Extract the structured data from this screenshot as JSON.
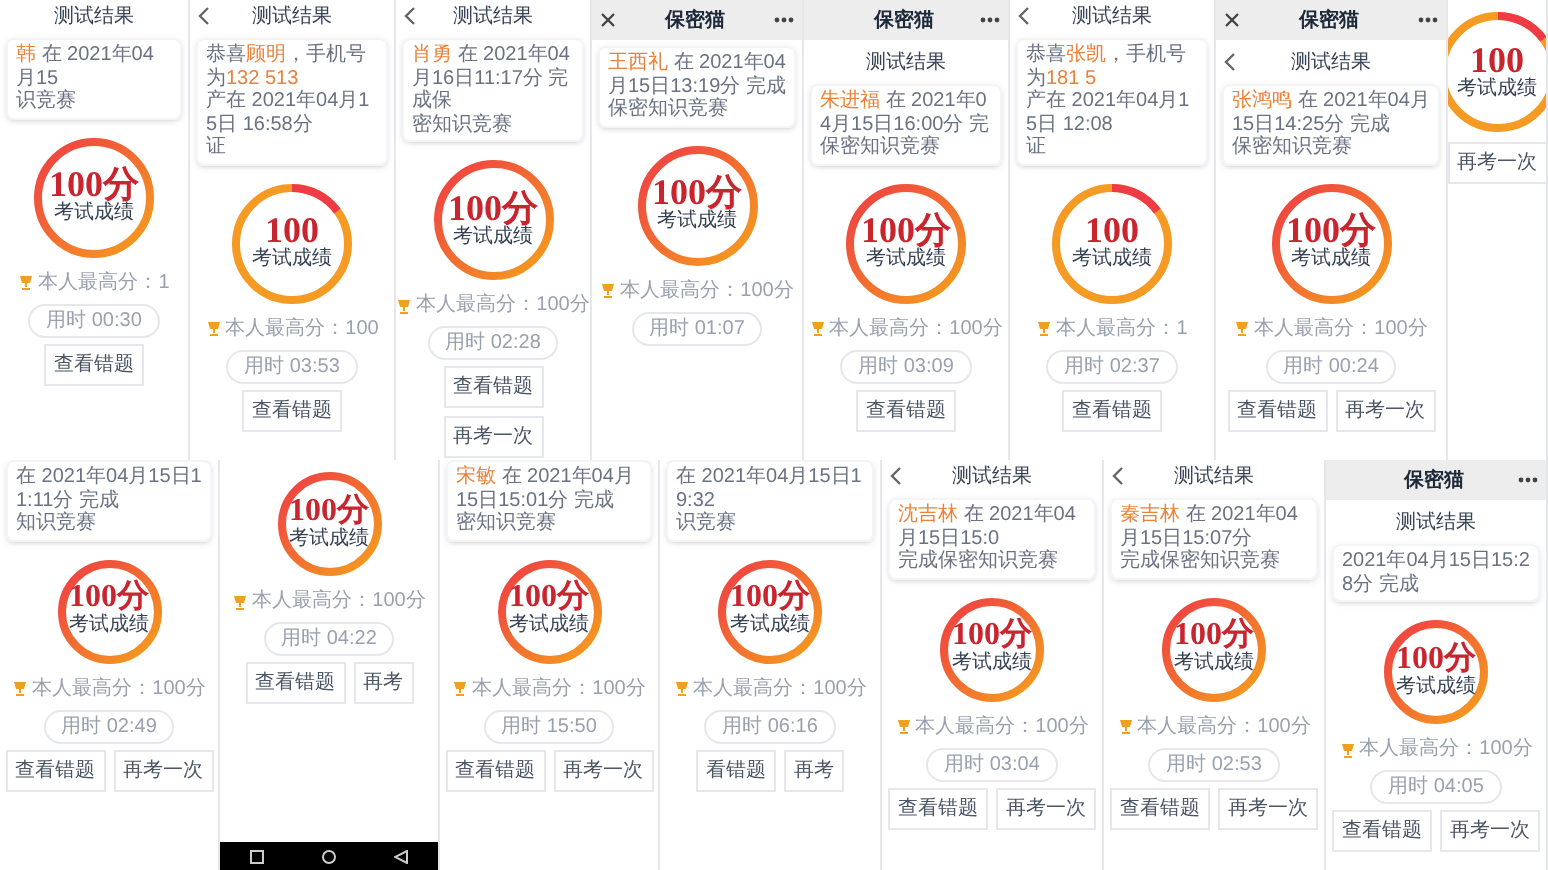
{
  "screens": [
    {
      "nav": {
        "back": false,
        "title": "测试结果"
      },
      "card": [
        [
          {
            "text": "韩",
            "highlight": true
          },
          {
            "text": " 在 2021年04月15",
            "highlight": false
          }
        ],
        [
          {
            "text": "识竞赛",
            "highlight": false
          }
        ]
      ],
      "kind": "gradient",
      "score": "100分",
      "score_label": "考试成绩",
      "best": "本人最高分：1",
      "time": "用时 00:30",
      "buttons": [
        "查看错题"
      ]
    },
    {
      "nav": {
        "back": true,
        "title": "测试结果"
      },
      "card": [
        [
          {
            "text": "恭喜",
            "highlight": false
          },
          {
            "text": "顾明",
            "highlight": true
          },
          {
            "text": "，手机号为",
            "highlight": false
          },
          {
            "text": "132 513",
            "highlight": true
          }
        ],
        [
          {
            "text": "产在 2021年04月15日 16:58分",
            "highlight": false
          }
        ],
        [
          {
            "text": "证",
            "highlight": false
          }
        ]
      ],
      "kind": "split",
      "score": "100",
      "score_label": "考试成绩",
      "best": "本人最高分：100",
      "time": "用时 03:53",
      "buttons": [
        "查看错题"
      ]
    },
    {
      "nav": {
        "back": true,
        "title": "测试结果"
      },
      "card": [
        [
          {
            "text": "肖勇",
            "highlight": true
          },
          {
            "text": " 在 2021年04月16日11:17分 完成保",
            "highlight": false
          }
        ],
        [
          {
            "text": "密知识竞赛",
            "highlight": false
          }
        ]
      ],
      "kind": "gradient",
      "score": "100分",
      "score_label": "考试成绩",
      "best": "本人最高分：100分",
      "time": "用时 02:28",
      "buttons": [
        "查看错题",
        "再考一次"
      ]
    },
    {
      "header": {
        "title": "保密猫",
        "close": true,
        "more": true
      },
      "card": [
        [
          {
            "text": "王西礼",
            "highlight": true
          },
          {
            "text": " 在 2021年04月15日13:19分 完成",
            "highlight": false
          }
        ],
        [
          {
            "text": "保密知识竞赛",
            "highlight": false
          }
        ]
      ],
      "kind": "gradient",
      "score": "100分",
      "score_label": "考试成绩",
      "best": "本人最高分：100分",
      "time": "用时 01:07"
    },
    {
      "header": {
        "title": "保密猫",
        "close": false,
        "more": true
      },
      "nav": {
        "back": false,
        "title": "测试结果"
      },
      "card": [
        [
          {
            "text": "朱进福",
            "highlight": true
          },
          {
            "text": " 在 2021年04月15日16:00分 完",
            "highlight": false
          }
        ],
        [
          {
            "text": "保密知识竞赛",
            "highlight": false
          }
        ]
      ],
      "kind": "gradient",
      "score": "100分",
      "score_label": "考试成绩",
      "best": "本人最高分：100分",
      "time": "用时 03:09",
      "buttons": [
        "查看错题"
      ]
    },
    {
      "nav": {
        "back": true,
        "title": "测试结果"
      },
      "card": [
        [
          {
            "text": "恭喜",
            "highlight": false
          },
          {
            "text": "张凯",
            "highlight": true
          },
          {
            "text": "，手机号为",
            "highlight": false
          },
          {
            "text": "181 5",
            "highlight": true
          }
        ],
        [
          {
            "text": "产在 2021年04月15日 12:08",
            "highlight": false
          }
        ],
        [
          {
            "text": "证",
            "highlight": false
          }
        ]
      ],
      "kind": "split",
      "score": "100",
      "score_label": "考试成绩",
      "best": "本人最高分：1",
      "time": "用时 02:37",
      "buttons": [
        "查看错题"
      ]
    },
    {
      "header": {
        "title": "保密猫",
        "close": true,
        "more": true
      },
      "nav": {
        "back": true,
        "title": "测试结果"
      },
      "card": [
        [
          {
            "text": "张鸿鸣",
            "highlight": true
          },
          {
            "text": " 在 2021年04月15日14:25分 完成",
            "highlight": false
          }
        ],
        [
          {
            "text": "保密知识竞赛",
            "highlight": false
          }
        ]
      ],
      "kind": "gradient",
      "score": "100分",
      "score_label": "考试成绩",
      "best": "本人最高分：100分",
      "time": "用时 00:24",
      "buttons": [
        "查看错题",
        "再考一次"
      ]
    },
    {
      "kind": "split",
      "score": "100",
      "score_label": "考试成绩",
      "buttons": [
        "再考一次"
      ]
    },
    {
      "card": [
        [
          {
            "text": "在 2021年04月15日11:11分 完成",
            "highlight": false
          }
        ],
        [
          {
            "text": "知识竞赛",
            "highlight": false
          }
        ]
      ],
      "kind": "gradient",
      "score": "100分",
      "score_label": "考试成绩",
      "best": "本人最高分：100分",
      "time": "用时 02:49",
      "buttons": [
        "查看错题",
        "再考一次"
      ]
    },
    {
      "kind": "gradient",
      "score": "100分",
      "score_label": "考试成绩",
      "best": "本人最高分：100分",
      "time": "用时 04:22",
      "buttons": [
        "查看错题",
        "再考"
      ],
      "nav_bar": true
    },
    {
      "card": [
        [
          {
            "text": "宋敏",
            "highlight": true
          },
          {
            "text": " 在 2021年04月15日15:01分 完成",
            "highlight": false
          }
        ],
        [
          {
            "text": "密知识竞赛",
            "highlight": false
          }
        ]
      ],
      "kind": "gradient",
      "score": "100分",
      "score_label": "考试成绩",
      "best": "本人最高分：100分",
      "time": "用时 15:50",
      "buttons": [
        "查看错题",
        "再考一次"
      ]
    },
    {
      "card": [
        [
          {
            "text": "在 2021年04月15日19:32",
            "highlight": false
          }
        ],
        [
          {
            "text": "识竞赛",
            "highlight": false
          }
        ]
      ],
      "kind": "gradient",
      "score": "100分",
      "score_label": "考试成绩",
      "best": "本人最高分：100分",
      "time": "用时 06:16",
      "buttons": [
        "看错题",
        "再考"
      ]
    },
    {
      "nav": {
        "back": true,
        "title": "测试结果"
      },
      "card": [
        [
          {
            "text": "沈吉林",
            "highlight": true
          },
          {
            "text": " 在 2021年04月15日15:0",
            "highlight": false
          }
        ],
        [
          {
            "text": "完成保密知识竞赛",
            "highlight": false
          }
        ]
      ],
      "kind": "gradient",
      "score": "100分",
      "score_label": "考试成绩",
      "best": "本人最高分：100分",
      "time": "用时 03:04",
      "buttons": [
        "查看错题",
        "再考一次"
      ]
    },
    {
      "nav": {
        "back": true,
        "title": "测试结果"
      },
      "card": [
        [
          {
            "text": "秦吉林",
            "highlight": true
          },
          {
            "text": " 在 2021年04月15日15:07分",
            "highlight": false
          }
        ],
        [
          {
            "text": "完成保密知识竞赛",
            "highlight": false
          }
        ]
      ],
      "kind": "gradient",
      "score": "100分",
      "score_label": "考试成绩",
      "best": "本人最高分：100分",
      "time": "用时 02:53",
      "buttons": [
        "查看错题",
        "再考一次"
      ]
    },
    {
      "header": {
        "title": "保密猫",
        "close": false,
        "more": true
      },
      "nav": {
        "back": false,
        "title": "测试结果"
      },
      "card": [
        [
          {
            "text": "2021年04月15日15:28分 完成",
            "highlight": false
          }
        ]
      ],
      "kind": "gradient",
      "score": "100分",
      "score_label": "考试成绩",
      "best": "本人最高分：100分",
      "time": "用时 04:05",
      "buttons": [
        "查看错题",
        "再考一次"
      ]
    }
  ]
}
